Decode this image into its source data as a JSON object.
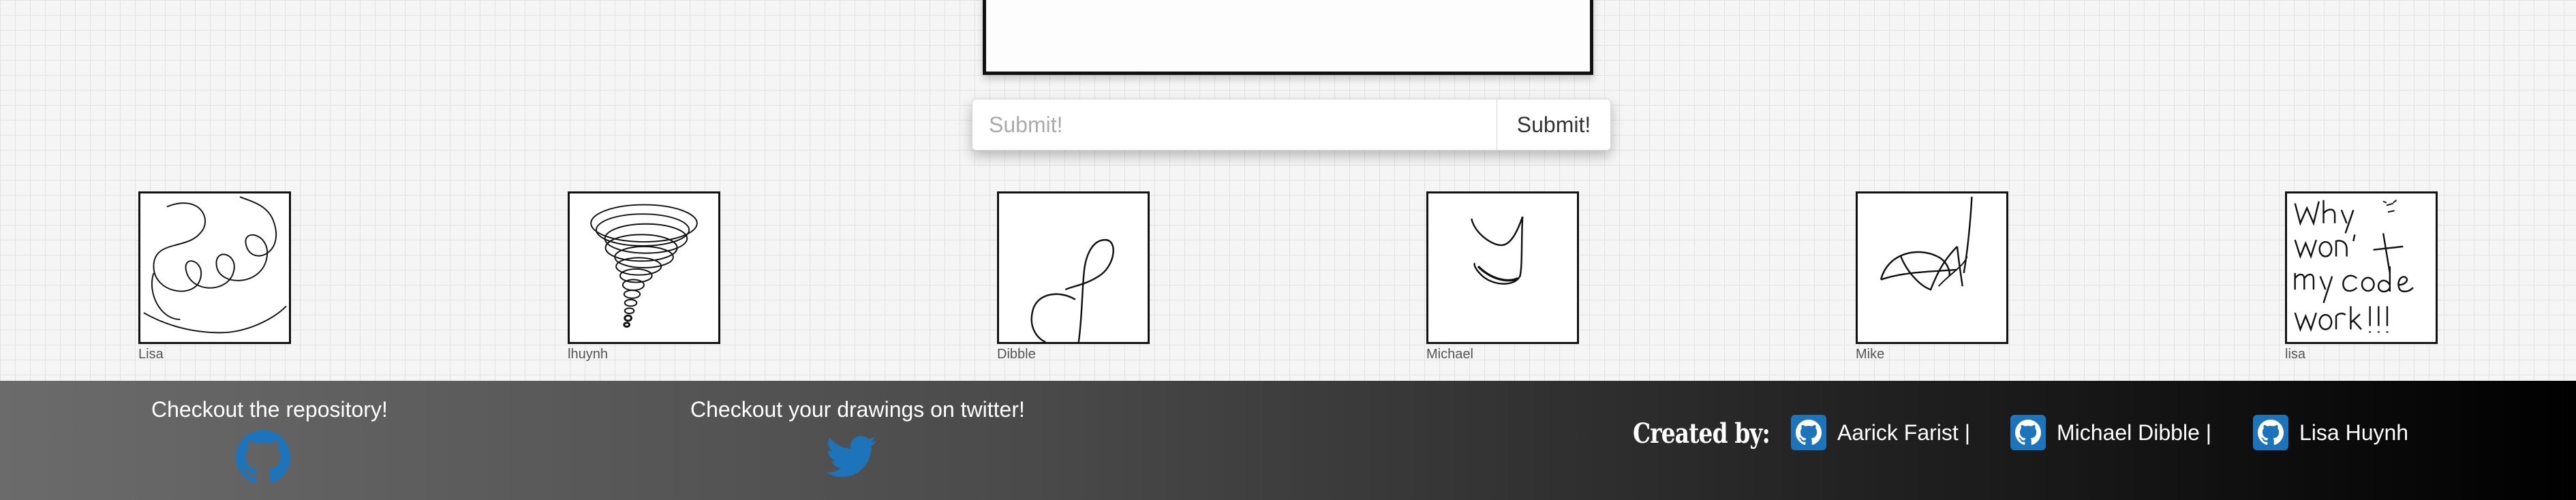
{
  "submit": {
    "placeholder": "Submit!",
    "button_label": "Submit!"
  },
  "gallery": {
    "items": [
      {
        "name": "Lisa"
      },
      {
        "name": "lhuynh"
      },
      {
        "name": "Dibble"
      },
      {
        "name": "Michael"
      },
      {
        "name": "Mike"
      },
      {
        "name": "lisa"
      }
    ]
  },
  "footer": {
    "repo_text": "Checkout the repository!",
    "twitter_text": "Checkout your drawings on twitter!",
    "created_by": "Created by:",
    "authors": [
      {
        "name": "Aarick Farist |",
        "icon": "github-icon"
      },
      {
        "name": "Michael Dibble |",
        "icon": "github-icon"
      },
      {
        "name": "Lisa Huynh",
        "icon": "github-icon"
      }
    ],
    "colors": {
      "badge": "#1e74bb",
      "icon_blue": "#1e74bb"
    }
  }
}
